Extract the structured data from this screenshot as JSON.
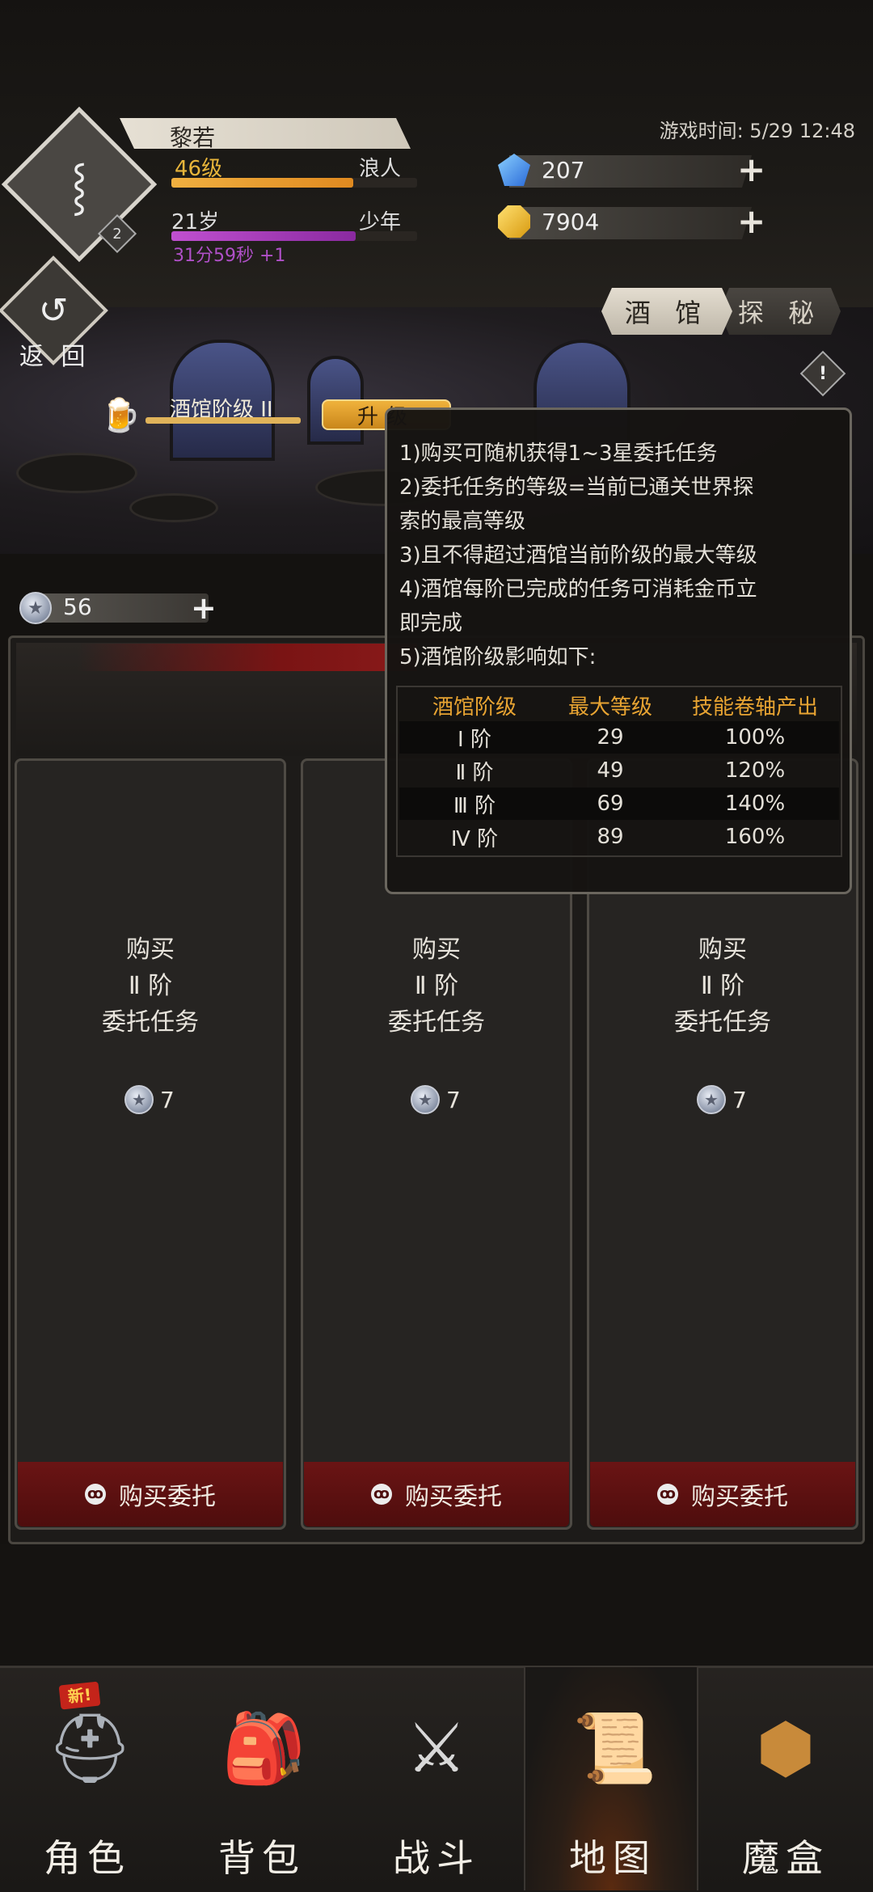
{
  "player": {
    "name": "黎若",
    "level": "46级",
    "title": "浪人",
    "age": "21岁",
    "life_stage": "少年",
    "timer": "31分59秒 +1",
    "rank_badge": "2",
    "level_progress": 0.74,
    "age_progress": 0.75
  },
  "game_time": "游戏时间: 5/29 12:48",
  "currencies": {
    "gems": "207",
    "gold": "7904",
    "silver": "56"
  },
  "nav_back": {
    "label": "返 回"
  },
  "tabs": [
    {
      "label": "酒 馆",
      "active": true
    },
    {
      "label": "探 秘",
      "active": false
    }
  ],
  "tavern": {
    "tier_label": "酒馆阶级 II",
    "upgrade_label": "升级"
  },
  "tooltip": {
    "lines": [
      "1)购买可随机获得1~3星委托任务",
      "2)委托任务的等级=当前已通关世界探",
      "索的最高等级",
      "3)且不得超过酒馆当前阶级的最大等级",
      "4)酒馆每阶已完成的任务可消耗金币立",
      "即完成",
      "5)酒馆阶级影响如下:"
    ],
    "table": {
      "headers": [
        "酒馆阶级",
        "最大等级",
        "技能卷轴产出"
      ],
      "rows": [
        [
          "Ⅰ 阶",
          "29",
          "100%"
        ],
        [
          "Ⅱ 阶",
          "49",
          "120%"
        ],
        [
          "Ⅲ 阶",
          "69",
          "140%"
        ],
        [
          "Ⅳ 阶",
          "89",
          "160%"
        ]
      ]
    }
  },
  "cards": [
    {
      "line1": "购买",
      "line2": "Ⅱ 阶",
      "line3": "委托任务",
      "cost": "7",
      "button": "购买委托"
    },
    {
      "line1": "购买",
      "line2": "Ⅱ 阶",
      "line3": "委托任务",
      "cost": "7",
      "button": "购买委托"
    },
    {
      "line1": "购买",
      "line2": "Ⅱ 阶",
      "line3": "委托任务",
      "cost": "7",
      "button": "购买委托"
    }
  ],
  "bottom_nav": [
    {
      "label": "角色",
      "icon": "helmet-icon",
      "badge": "新!"
    },
    {
      "label": "背包",
      "icon": "backpack-icon"
    },
    {
      "label": "战斗",
      "icon": "sword-shield-icon"
    },
    {
      "label": "地图",
      "icon": "scroll-map-icon",
      "active": true
    },
    {
      "label": "魔盒",
      "icon": "magic-box-icon"
    }
  ],
  "colors": {
    "gold_text": "#e8b53a",
    "age_bar": "#b040c0",
    "button_red": "#6a1414",
    "tooltip_header": "#e8a432"
  }
}
